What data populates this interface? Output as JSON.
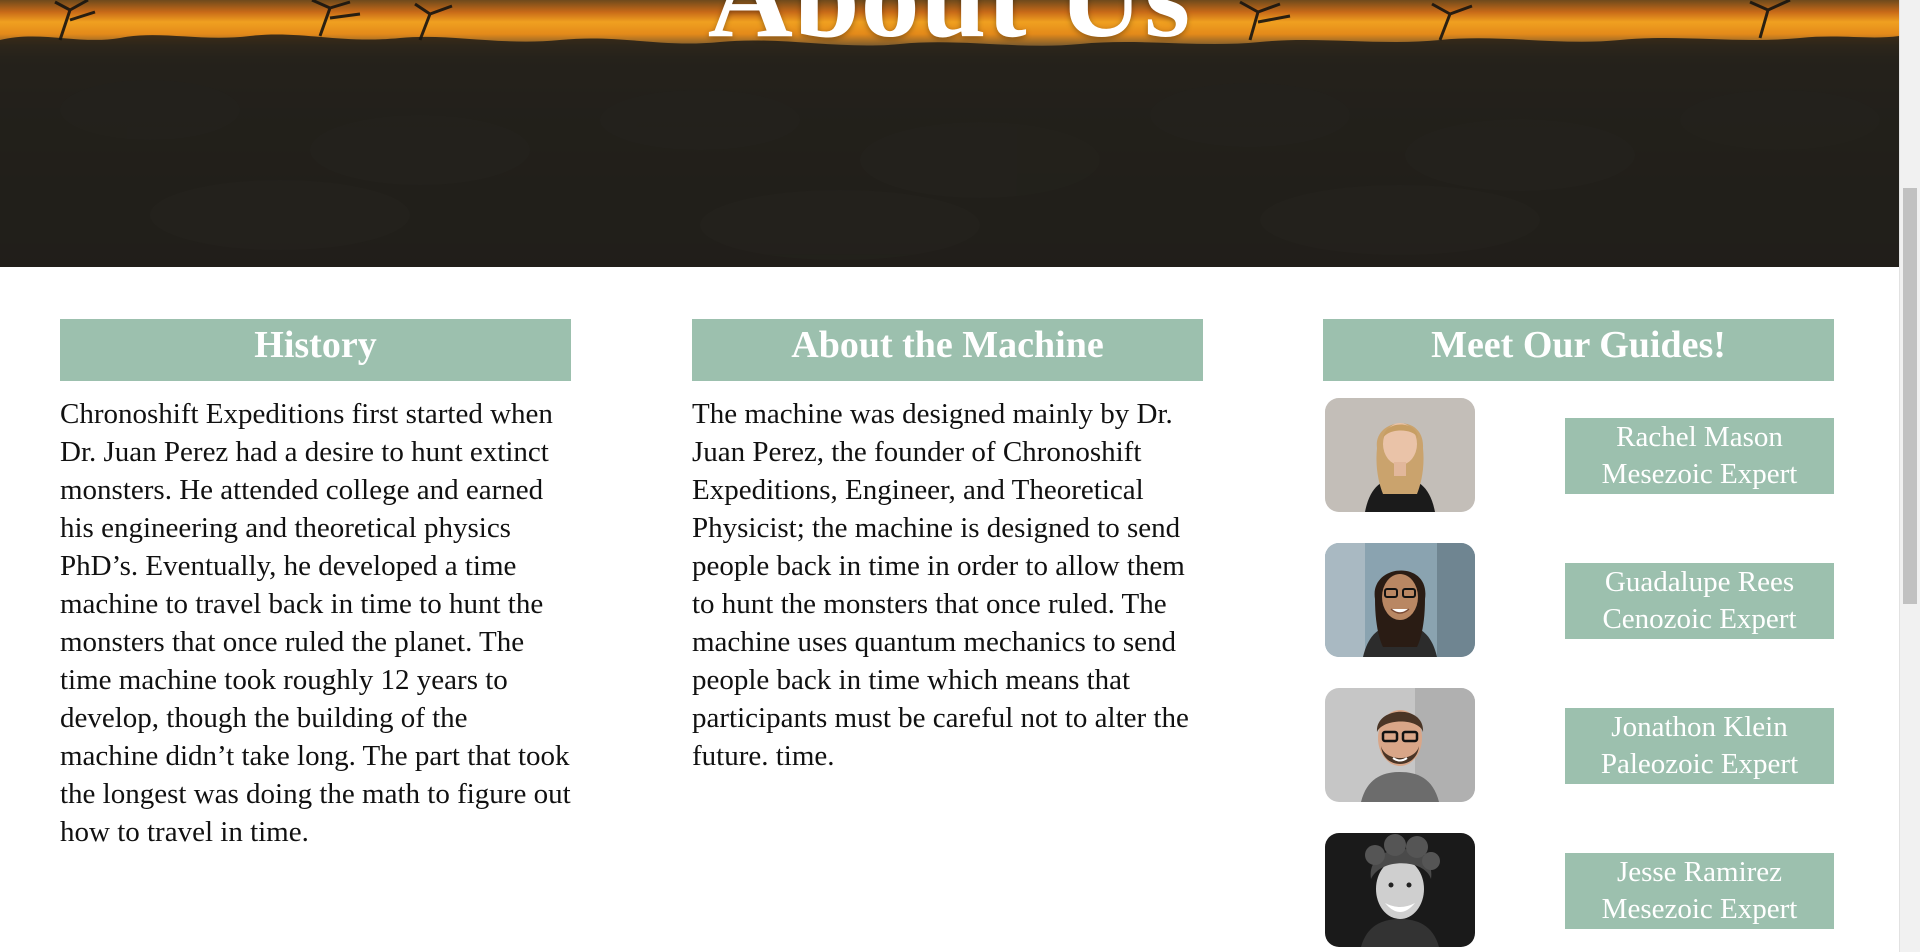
{
  "hero": {
    "title": "About Us"
  },
  "history": {
    "heading": "History",
    "text": "Chronoshift Expeditions first started when Dr. Juan Perez had a desire to hunt extinct monsters. He attended college and earned his engineering and theoretical physics PhD’s. Eventually, he developed a time machine to travel back in time to hunt the monsters that once ruled the planet. The time machine took roughly 12 years to develop, though the building of the machine didn’t take long. The part that took the longest was doing the math to figure out how to travel in time."
  },
  "machine": {
    "heading": "About the Machine",
    "text": "The machine was designed mainly by Dr. Juan Perez, the founder of Chronoshift Expeditions, Engineer, and Theoretical Physicist; the machine is designed to send people back in time in order to allow them to hunt the monsters that once ruled. The machine uses quantum mechanics to send people back in time which means that participants must be careful not to alter the future. time."
  },
  "guides": {
    "heading": "Meet Our Guides!",
    "items": [
      {
        "name": "Rachel Mason",
        "role": "Mesezoic Expert"
      },
      {
        "name": "Guadalupe Rees",
        "role": "Cenozoic Expert"
      },
      {
        "name": "Jonathon Klein",
        "role": "Paleozoic Expert"
      },
      {
        "name": "Jesse Ramirez",
        "role": "Mesezoic Expert"
      }
    ]
  },
  "colors": {
    "accent": "#9cc0ae",
    "text": "#111111",
    "header_text": "#ffffff"
  }
}
